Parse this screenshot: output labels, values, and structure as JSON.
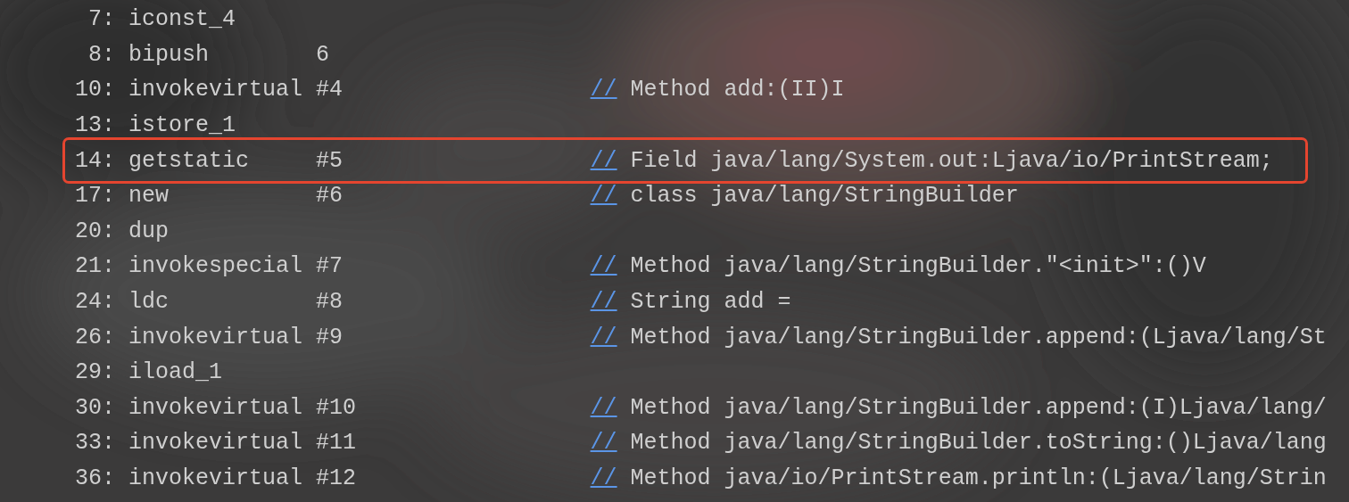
{
  "rows": [
    {
      "index": "7:",
      "opcode": "iconst_4",
      "highlighted": false
    },
    {
      "index": "8:",
      "opcode": "bipush",
      "operand": "6",
      "highlighted": false
    },
    {
      "index": "10:",
      "opcode": "invokevirtual",
      "operand": "#4",
      "comment_marker": "//",
      "comment": "Method add:(II)I",
      "highlighted": false
    },
    {
      "index": "13:",
      "opcode": "istore_1",
      "highlighted": false
    },
    {
      "index": "14:",
      "opcode": "getstatic",
      "operand": "#5",
      "comment_marker": "//",
      "comment": "Field java/lang/System.out:Ljava/io/PrintStream;",
      "highlighted": true
    },
    {
      "index": "17:",
      "opcode": "new",
      "operand": "#6",
      "comment_marker": "//",
      "comment": "class java/lang/StringBuilder",
      "highlighted": false
    },
    {
      "index": "20:",
      "opcode": "dup",
      "highlighted": false
    },
    {
      "index": "21:",
      "opcode": "invokespecial",
      "operand": "#7",
      "comment_marker": "//",
      "comment": "Method java/lang/StringBuilder.\"<init>\":()V",
      "highlighted": false
    },
    {
      "index": "24:",
      "opcode": "ldc",
      "operand": "#8",
      "comment_marker": "//",
      "comment": "String add =",
      "highlighted": false
    },
    {
      "index": "26:",
      "opcode": "invokevirtual",
      "operand": "#9",
      "comment_marker": "//",
      "comment": "Method java/lang/StringBuilder.append:(Ljava/lang/St",
      "highlighted": false
    },
    {
      "index": "29:",
      "opcode": "iload_1",
      "highlighted": false
    },
    {
      "index": "30:",
      "opcode": "invokevirtual",
      "operand": "#10",
      "comment_marker": "//",
      "comment": "Method java/lang/StringBuilder.append:(I)Ljava/lang/",
      "highlighted": false
    },
    {
      "index": "33:",
      "opcode": "invokevirtual",
      "operand": "#11",
      "comment_marker": "//",
      "comment": "Method java/lang/StringBuilder.toString:()Ljava/lang",
      "highlighted": false
    },
    {
      "index": "36:",
      "opcode": "invokevirtual",
      "operand": "#12",
      "comment_marker": "//",
      "comment": "Method java/io/PrintStream.println:(Ljava/lang/Strin",
      "highlighted": false
    }
  ]
}
